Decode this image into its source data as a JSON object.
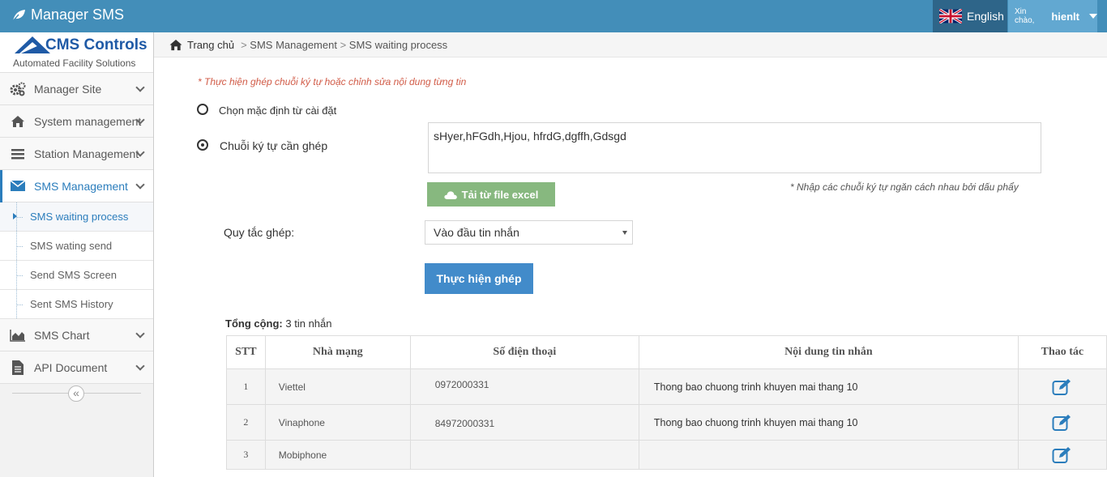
{
  "app": {
    "title": "Manager SMS"
  },
  "header": {
    "language": "English",
    "greeting": "Xin chào,",
    "username": "hienlt"
  },
  "logo": {
    "name": "CMS Controls",
    "tagline": "Automated Facility Solutions"
  },
  "sidebar": {
    "items": [
      {
        "label": "Manager Site",
        "icon": "cogs-icon"
      },
      {
        "label": "System management",
        "icon": "home-icon"
      },
      {
        "label": "Station Management",
        "icon": "list-icon"
      },
      {
        "label": "SMS Management",
        "icon": "envelope-icon"
      },
      {
        "label": "SMS Chart",
        "icon": "area-chart-icon"
      },
      {
        "label": "API Document",
        "icon": "file-icon"
      }
    ],
    "sms_submenu": [
      "SMS waiting process",
      "SMS wating send",
      "Send SMS Screen",
      "Sent SMS History"
    ],
    "collapse": "«"
  },
  "breadcrumb": {
    "home": "Trang chủ",
    "sep": ">",
    "level1": "SMS Management",
    "level2": "SMS waiting process"
  },
  "form": {
    "note": "* Thực hiện ghép chuỗi ký tự  hoặc chỉnh sửa nội dung từng tin",
    "option_default": "Chọn mặc định từ cài đặt",
    "option_string": "Chuỗi ký tự cần ghép",
    "string_value": "sHyer,hFGdh,Hjou, hfrdG,dgffh,Gdsgd",
    "string_hint": "* Nhập các chuỗi ký tự ngăn cách nhau bởi dấu phẩy",
    "upload_button": "Tải từ file excel",
    "rule_label": "Quy tắc ghép:",
    "rule_value": "Vào đầu tin nhắn",
    "submit_button": "Thực hiện ghép"
  },
  "summary": {
    "label": "Tổng cộng:",
    "value": "3 tin nhắn"
  },
  "table": {
    "headers": [
      "STT",
      "Nhà mạng",
      "Số điện thoại",
      "Nội dung tin nhắn",
      "Thao tác"
    ],
    "rows": [
      {
        "stt": "1",
        "network": "Viettel",
        "phone": "0972000331",
        "content": "Thong bao chuong trinh khuyen mai thang 10"
      },
      {
        "stt": "2",
        "network": "Vinaphone",
        "phone": "84972000331",
        "content": "Thong bao chuong trinh khuyen mai thang 10"
      },
      {
        "stt": "3",
        "network": "Mobiphone",
        "phone": "",
        "content": ""
      }
    ]
  },
  "colors": {
    "navbar": "#438eb9",
    "accent": "#2b7dbc",
    "green_button": "#87b87f",
    "blue_button": "#428bca",
    "note_red": "#d15b47"
  }
}
